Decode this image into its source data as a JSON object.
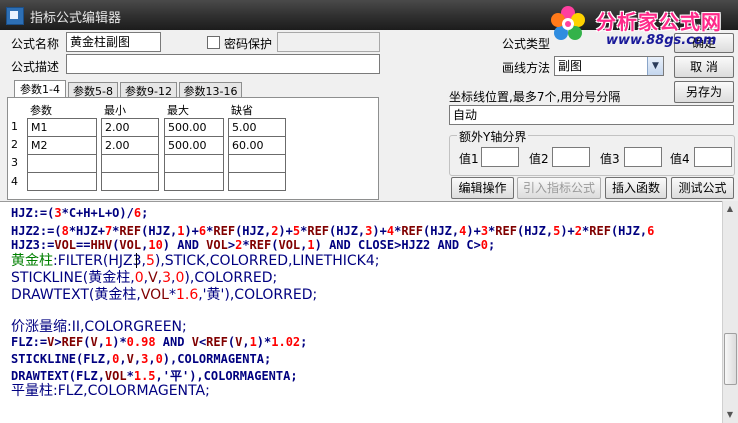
{
  "window": {
    "title": "指标公式编辑器"
  },
  "logo": {
    "text": "分析家公式网",
    "url": "www.88gs.com"
  },
  "form": {
    "name_label": "公式名称",
    "name_value": "黄金柱副图",
    "password_label": "密码保护",
    "desc_label": "公式描述",
    "desc_value": "",
    "type_label": "公式类型",
    "draw_label": "画线方法",
    "draw_value": "副图",
    "ok": "确定",
    "cancel": "取 消",
    "save_as": "另存为"
  },
  "tabs": [
    "参数1-4",
    "参数5-8",
    "参数9-12",
    "参数13-16"
  ],
  "param_headers": [
    "参数",
    "最小",
    "最大",
    "缺省"
  ],
  "params": [
    {
      "n": "1",
      "name": "M1",
      "min": "2.00",
      "max": "500.00",
      "def": "5.00"
    },
    {
      "n": "2",
      "name": "M2",
      "min": "2.00",
      "max": "500.00",
      "def": "60.00"
    },
    {
      "n": "3",
      "name": "",
      "min": "",
      "max": "",
      "def": ""
    },
    {
      "n": "4",
      "name": "",
      "min": "",
      "max": "",
      "def": ""
    }
  ],
  "axis": {
    "label": "坐标线位置,最多7个,用分号分隔",
    "value": "自动",
    "extra_title": "额外Y轴分界",
    "value_labels": [
      "值1",
      "值2",
      "值3",
      "值4"
    ]
  },
  "buttons": {
    "edit_ops": "编辑操作",
    "import": "引入指标公式",
    "insert_func": "插入函数",
    "test": "测试公式"
  },
  "colors": {
    "keyword": "#000080",
    "number": "#ff0000",
    "func": "#800000",
    "var_green": "#008000",
    "title_bar": "#2f2f2f",
    "logo_pink": "#ff2a8a"
  },
  "code": [
    [
      [
        "HJZ:=(",
        "k"
      ],
      [
        "3",
        "n"
      ],
      [
        "*C+H+L+O)/",
        "k"
      ],
      [
        "6",
        "n"
      ],
      [
        ";",
        "k"
      ]
    ],
    [
      [
        "HJZ2:=(",
        "k"
      ],
      [
        "8",
        "n"
      ],
      [
        "*HJZ+",
        "k"
      ],
      [
        "7",
        "n"
      ],
      [
        "*",
        "k"
      ],
      [
        "REF",
        "f"
      ],
      [
        "(HJZ,",
        "k"
      ],
      [
        "1",
        "n"
      ],
      [
        ")+",
        "k"
      ],
      [
        "6",
        "n"
      ],
      [
        "*",
        "k"
      ],
      [
        "REF",
        "f"
      ],
      [
        "(HJZ,",
        "k"
      ],
      [
        "2",
        "n"
      ],
      [
        ")+",
        "k"
      ],
      [
        "5",
        "n"
      ],
      [
        "*",
        "k"
      ],
      [
        "REF",
        "f"
      ],
      [
        "(HJZ,",
        "k"
      ],
      [
        "3",
        "n"
      ],
      [
        ")+",
        "k"
      ],
      [
        "4",
        "n"
      ],
      [
        "*",
        "k"
      ],
      [
        "REF",
        "f"
      ],
      [
        "(HJZ,",
        "k"
      ],
      [
        "4",
        "n"
      ],
      [
        ")+",
        "k"
      ],
      [
        "3",
        "n"
      ],
      [
        "*",
        "k"
      ],
      [
        "REF",
        "f"
      ],
      [
        "(HJZ,",
        "k"
      ],
      [
        "5",
        "n"
      ],
      [
        ")+",
        "k"
      ],
      [
        "2",
        "n"
      ],
      [
        "*",
        "k"
      ],
      [
        "REF",
        "f"
      ],
      [
        "(HJZ,",
        "k"
      ],
      [
        "6",
        "n"
      ]
    ],
    [
      [
        "HJZ3:=",
        "k"
      ],
      [
        "VOL",
        "f"
      ],
      [
        "==",
        "k"
      ],
      [
        "HHV",
        "f"
      ],
      [
        "(",
        "k"
      ],
      [
        "VOL",
        "f"
      ],
      [
        ",",
        "k"
      ],
      [
        "10",
        "n"
      ],
      [
        ") AND ",
        "k"
      ],
      [
        "VOL",
        "f"
      ],
      [
        ">",
        "k"
      ],
      [
        "2",
        "n"
      ],
      [
        "*",
        "k"
      ],
      [
        "REF",
        "f"
      ],
      [
        "(",
        "k"
      ],
      [
        "VOL",
        "f"
      ],
      [
        ",",
        "k"
      ],
      [
        "1",
        "n"
      ],
      [
        ") AND CLOSE>HJZ2 AND C>",
        "k"
      ],
      [
        "0",
        "n"
      ],
      [
        ";",
        "k"
      ]
    ],
    [
      [
        "黄金柱",
        "g"
      ],
      [
        ":FILTER(HJZ3,",
        "k"
      ],
      [
        "5",
        "n"
      ],
      [
        "),STICK,COLORRED,LINETHICK4;",
        "k"
      ]
    ],
    [
      [
        "STICKLINE",
        "k"
      ],
      [
        "(黄金柱,",
        "k"
      ],
      [
        "0",
        "n"
      ],
      [
        ",",
        "k"
      ],
      [
        "V",
        "f"
      ],
      [
        ",",
        "k"
      ],
      [
        "3",
        "n"
      ],
      [
        ",",
        "k"
      ],
      [
        "0",
        "n"
      ],
      [
        "),COLORRED;",
        "k"
      ]
    ],
    [
      [
        "DRAWTEXT",
        "k"
      ],
      [
        "(黄金柱,",
        "k"
      ],
      [
        "VOL",
        "f"
      ],
      [
        "*",
        "k"
      ],
      [
        "1.6",
        "n"
      ],
      [
        ",'黄'),COLORRED;",
        "k"
      ]
    ],
    [
      [
        "",
        "k"
      ]
    ],
    [
      [
        "价涨量缩",
        "k"
      ],
      [
        ":II,COLORGREEN;",
        "k"
      ]
    ],
    [
      [
        "FLZ:=",
        "k"
      ],
      [
        "V",
        "f"
      ],
      [
        ">",
        "k"
      ],
      [
        "REF",
        "f"
      ],
      [
        "(",
        "k"
      ],
      [
        "V",
        "f"
      ],
      [
        ",",
        "k"
      ],
      [
        "1",
        "n"
      ],
      [
        ")*",
        "k"
      ],
      [
        "0.98",
        "n"
      ],
      [
        " AND ",
        "k"
      ],
      [
        "V",
        "f"
      ],
      [
        "<",
        "k"
      ],
      [
        "REF",
        "f"
      ],
      [
        "(",
        "k"
      ],
      [
        "V",
        "f"
      ],
      [
        ",",
        "k"
      ],
      [
        "1",
        "n"
      ],
      [
        ")*",
        "k"
      ],
      [
        "1.02",
        "n"
      ],
      [
        ";",
        "k"
      ]
    ],
    [
      [
        "STICKLINE",
        "k"
      ],
      [
        "(FLZ,",
        "k"
      ],
      [
        "0",
        "n"
      ],
      [
        ",",
        "k"
      ],
      [
        "V",
        "f"
      ],
      [
        ",",
        "k"
      ],
      [
        "3",
        "n"
      ],
      [
        ",",
        "k"
      ],
      [
        "0",
        "n"
      ],
      [
        "),COLORMAGENTA;",
        "k"
      ]
    ],
    [
      [
        "DRAWTEXT",
        "k"
      ],
      [
        "(FLZ,",
        "k"
      ],
      [
        "VOL",
        "f"
      ],
      [
        "*",
        "k"
      ],
      [
        "1.5",
        "n"
      ],
      [
        ",'平'),COLORMAGENTA;",
        "k"
      ]
    ],
    [
      [
        "平量柱",
        "k"
      ],
      [
        ":FLZ,COLORMAGENTA;",
        "k"
      ]
    ]
  ]
}
